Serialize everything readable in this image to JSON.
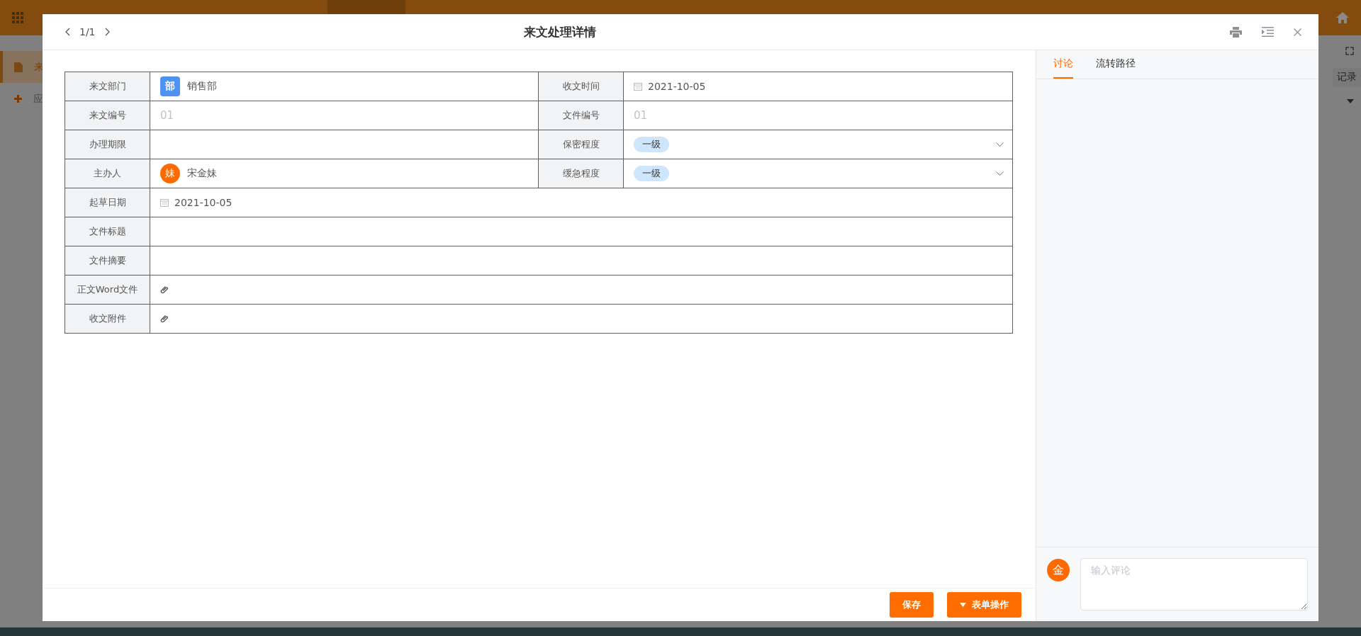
{
  "background": {
    "sidebar_items": [
      {
        "label": "来",
        "selected": true
      },
      {
        "label": "应",
        "selected": false
      }
    ],
    "side_button": "记录"
  },
  "modal": {
    "pager": "1/1",
    "title": "来文处理详情"
  },
  "form": {
    "rows": [
      {
        "fields": [
          {
            "label": "来文部门",
            "kind": "department",
            "badge": "部",
            "value": "销售部"
          },
          {
            "label": "收文时间",
            "kind": "date",
            "value": "2021-10-05"
          }
        ]
      },
      {
        "fields": [
          {
            "label": "来文编号",
            "kind": "hint",
            "placeholder": "01"
          },
          {
            "label": "文件编号",
            "kind": "hint",
            "placeholder": "01"
          }
        ]
      },
      {
        "fields": [
          {
            "label": "办理期限",
            "kind": "empty"
          },
          {
            "label": "保密程度",
            "kind": "select",
            "value": "一级"
          }
        ]
      },
      {
        "fields": [
          {
            "label": "主办人",
            "kind": "person",
            "avatar": "妹",
            "value": "宋金妹"
          },
          {
            "label": "缓急程度",
            "kind": "select",
            "value": "一级"
          }
        ]
      },
      {
        "fields": [
          {
            "label": "起草日期",
            "kind": "date",
            "value": "2021-10-05"
          }
        ]
      },
      {
        "fields": [
          {
            "label": "文件标题",
            "kind": "empty"
          }
        ]
      },
      {
        "fields": [
          {
            "label": "文件摘要",
            "kind": "empty"
          }
        ]
      },
      {
        "fields": [
          {
            "label": "正文Word文件",
            "kind": "attachment"
          }
        ]
      },
      {
        "fields": [
          {
            "label": "收文附件",
            "kind": "attachment"
          }
        ]
      }
    ]
  },
  "footer": {
    "buttons": [
      {
        "label": "保存",
        "kind": "plain"
      },
      {
        "label": "表单操作",
        "kind": "menu"
      }
    ]
  },
  "panel": {
    "tabs": [
      {
        "label": "讨论",
        "selected": true
      },
      {
        "label": "流转路径",
        "selected": false
      }
    ],
    "comment": {
      "avatar": "金",
      "placeholder": "输入评论"
    }
  }
}
